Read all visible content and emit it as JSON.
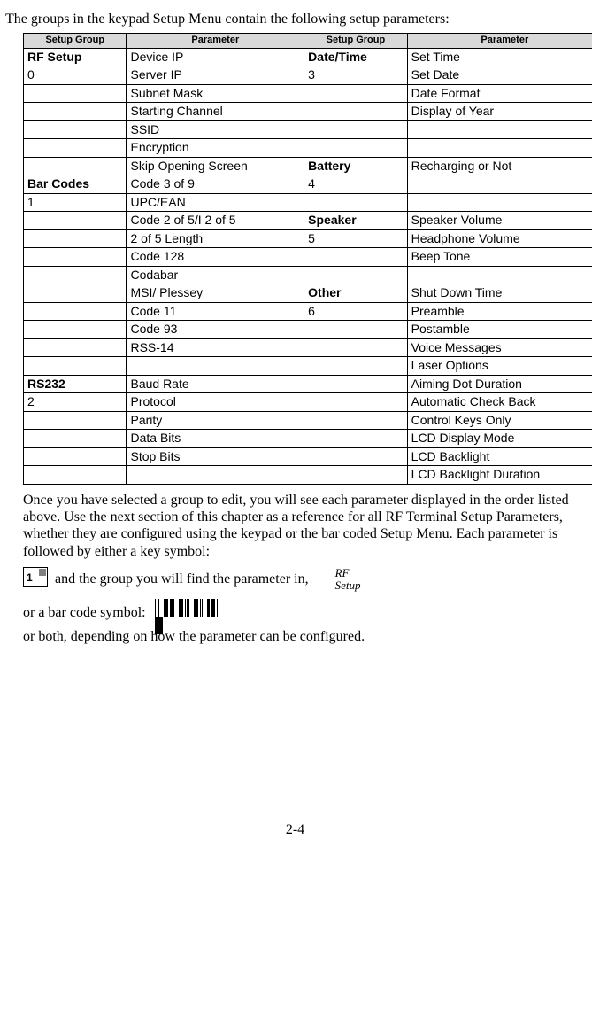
{
  "intro": "The groups in the keypad Setup Menu contain the following setup parameters:",
  "table": {
    "headers": [
      "Setup Group",
      "Parameter",
      "Setup Group",
      "Parameter"
    ],
    "rows": [
      {
        "c0": "RF Setup",
        "b0": true,
        "c1": "Device IP",
        "c2": "Date/Time",
        "b2": true,
        "c3": "Set Time"
      },
      {
        "c0": "0",
        "c1": "Server IP",
        "c2": "3",
        "c3": "Set Date"
      },
      {
        "c0": "",
        "c1": "Subnet Mask",
        "c2": "",
        "c3": "Date Format"
      },
      {
        "c0": "",
        "c1": "Starting Channel",
        "c2": "",
        "c3": "Display of Year"
      },
      {
        "c0": "",
        "c1": "SSID",
        "c2": "",
        "c3": ""
      },
      {
        "c0": "",
        "c1": "Encryption",
        "c2": "",
        "c3": ""
      },
      {
        "c0": "",
        "c1": "Skip Opening Screen",
        "c2": "Battery",
        "b2": true,
        "c3": "Recharging or Not"
      },
      {
        "c0": "Bar Codes",
        "b0": true,
        "c1": "Code 3 of 9",
        "c2": "4",
        "c3": ""
      },
      {
        "c0": "1",
        "c1": "UPC/EAN",
        "c2": "",
        "c3": ""
      },
      {
        "c0": "",
        "c1": "Code 2 of 5/I 2 of 5",
        "c2": "Speaker",
        "b2": true,
        "c3": "Speaker Volume"
      },
      {
        "c0": "",
        "c1": "2 of 5 Length",
        "c2": "5",
        "c3": "Headphone Volume"
      },
      {
        "c0": "",
        "c1": "Code 128",
        "c2": "",
        "c3": "Beep Tone"
      },
      {
        "c0": "",
        "c1": "Codabar",
        "c2": "",
        "c3": ""
      },
      {
        "c0": "",
        "c1": "MSI/ Plessey",
        "c2": "Other",
        "b2": true,
        "c3": "Shut Down Time"
      },
      {
        "c0": "",
        "c1": "Code 11",
        "c2": "6",
        "c3": "Preamble"
      },
      {
        "c0": "",
        "c1": "Code 93",
        "c2": "",
        "c3": "Postamble"
      },
      {
        "c0": "",
        "c1": "RSS-14",
        "c2": "",
        "c3": "Voice Messages"
      },
      {
        "c0": "",
        "c1": "",
        "c2": "",
        "c3": "Laser Options"
      },
      {
        "c0": "RS232",
        "b0": true,
        "c1": "Baud Rate",
        "c2": "",
        "c3": "Aiming Dot Duration"
      },
      {
        "c0": "2",
        "c1": "Protocol",
        "c2": "",
        "c3": "Automatic Check Back"
      },
      {
        "c0": "",
        "c1": "Parity",
        "c2": "",
        "c3": "Control Keys Only"
      },
      {
        "c0": "",
        "c1": "Data Bits",
        "c2": "",
        "c3": "LCD Display Mode"
      },
      {
        "c0": "",
        "c1": "Stop Bits",
        "c2": "",
        "c3": "LCD Backlight"
      },
      {
        "c0": "",
        "c1": "",
        "c2": "",
        "c3": "LCD Backlight Duration"
      }
    ]
  },
  "para1": "Once you have selected a group to edit, you will see each parameter displayed in the order listed above.  Use the next section of this chapter as a reference for all RF Terminal Setup Parameters, whether they are configured using the keypad or the bar coded Setup Menu.  Each parameter is followed by either a key symbol:",
  "key_num": "1",
  "line2_mid": " and the group you will find the parameter in, ",
  "rf_label_1": "RF",
  "rf_label_2": "Setup",
  "line3_pre": "or a bar code symbol:  ",
  "para3": "or both, depending on how the parameter can be configured.",
  "page_number": "2-4"
}
